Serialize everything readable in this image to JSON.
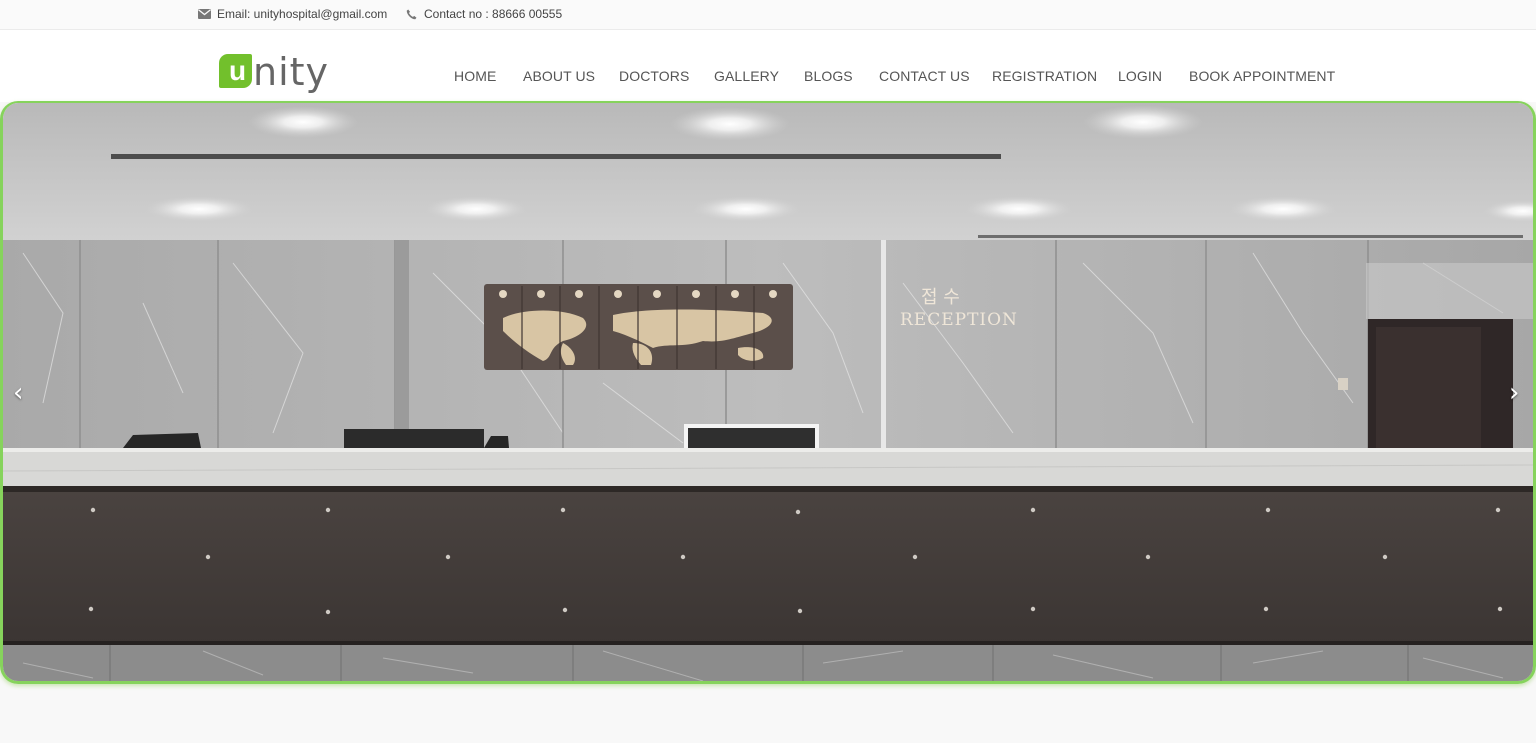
{
  "topbar": {
    "email_text": "Email: unityhospital@gmail.com",
    "contact_text": "Contact no : 88666 00555",
    "email_icon": "envelope-icon",
    "phone_icon": "phone-icon"
  },
  "logo": {
    "mark_letter": "u",
    "text": "nity"
  },
  "nav": {
    "items": [
      {
        "label": "HOME"
      },
      {
        "label": "ABOUT US"
      },
      {
        "label": "DOCTORS"
      },
      {
        "label": "GALLERY"
      },
      {
        "label": "BLOGS"
      },
      {
        "label": "CONTACT US"
      },
      {
        "label": "REGISTRATION"
      },
      {
        "label": "LOGIN"
      },
      {
        "label": "BOOK APPOINTMENT"
      }
    ]
  },
  "hero": {
    "sign_korean": "접   수",
    "sign_english": "RECEPTION",
    "prev_glyph": "‹",
    "next_glyph": "›"
  },
  "colors": {
    "brand_green": "#72c02c",
    "nav_text": "#555555",
    "accent_border": "#86d35c"
  }
}
